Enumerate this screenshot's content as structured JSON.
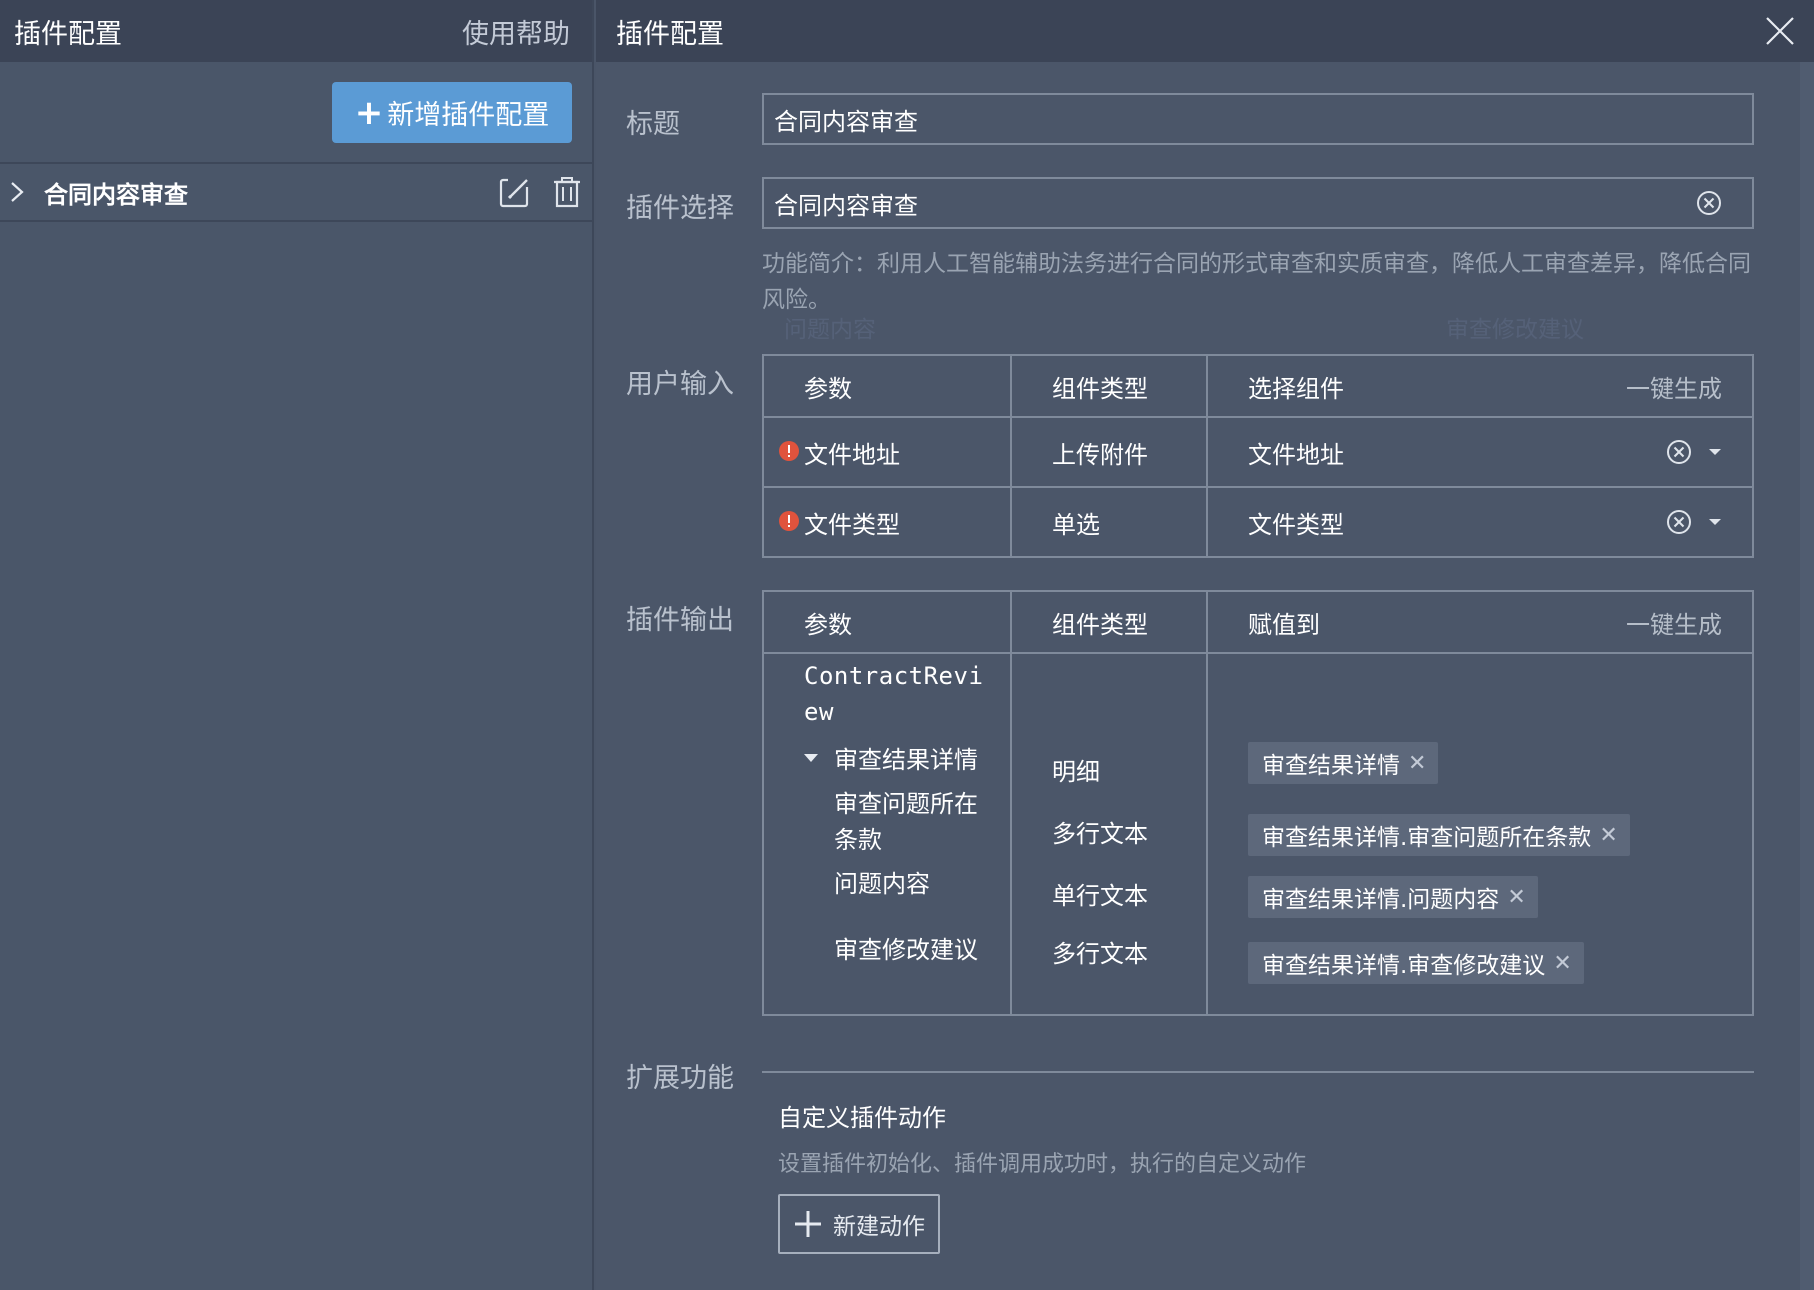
{
  "left": {
    "title": "插件配置",
    "help": "使用帮助",
    "add_button": "新增插件配置",
    "items": [
      {
        "label": "合同内容审查"
      }
    ]
  },
  "right": {
    "title": "插件配置",
    "title_label": "标题",
    "title_value": "合同内容审查",
    "plugin_label": "插件选择",
    "plugin_value": "合同内容审查",
    "description": "功能简介：利用人工智能辅助法务进行合同的形式审查和实质审查，降低人工审查差异，降低合同风险。",
    "ghost_texts": [
      "问题内容",
      "审查修改建议",
      "问题内容"
    ],
    "input_section": {
      "label": "用户输入",
      "headers": [
        "参数",
        "组件类型",
        "选择组件",
        "一键生成"
      ],
      "rows": [
        {
          "param": "文件地址",
          "type": "上传附件",
          "select": "文件地址"
        },
        {
          "param": "文件类型",
          "type": "单选",
          "select": "文件类型"
        }
      ]
    },
    "output_section": {
      "label": "插件输出",
      "headers": [
        "参数",
        "组件类型",
        "赋值到",
        "一键生成"
      ],
      "root": "ContractReview",
      "root_line1": "ContractRevi",
      "root_line2": "ew",
      "rows": [
        {
          "param": "审查结果详情",
          "type": "明细",
          "tag": "审查结果详情"
        },
        {
          "param_line1": "审查问题所在",
          "param_line2": "条款",
          "type": "多行文本",
          "tag": "审查结果详情.审查问题所在条款"
        },
        {
          "param": "问题内容",
          "type": "单行文本",
          "tag": "审查结果详情.问题内容"
        },
        {
          "param": "审查修改建议",
          "type": "多行文本",
          "tag": "审查结果详情.审查修改建议"
        }
      ]
    },
    "extension": {
      "label": "扩展功能",
      "title": "自定义插件动作",
      "desc": "设置插件初始化、插件调用成功时，执行的自定义动作",
      "button": "新建动作"
    }
  },
  "colors": {
    "primary_button": "#5b9bd5",
    "required_icon": "#e0533d",
    "header_bg": "#3b4456",
    "panel_bg": "#4b5669"
  }
}
